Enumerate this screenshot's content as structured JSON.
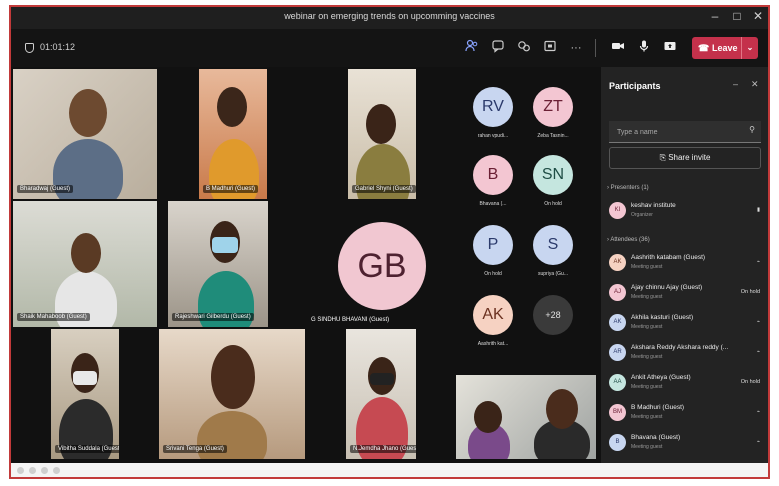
{
  "window": {
    "title": "webinar on emerging trends on upcomming vaccines",
    "minimize": "–",
    "maximize": "□",
    "close": "✕"
  },
  "toolbar": {
    "timer": "01:01:12",
    "leave_label": "Leave",
    "icons": [
      "people-icon",
      "chat-icon",
      "reactions-icon",
      "share-tray-icon",
      "more-icon",
      "camera-icon",
      "mic-icon",
      "share-screen-icon"
    ]
  },
  "video_tiles": [
    {
      "name": "Bharadwaj (Guest)"
    },
    {
      "name": "B Madhuri (Guest)"
    },
    {
      "name": "Gabriel Shyni (Guest)"
    },
    {
      "name": "Shaik Mahaboob (Guest)"
    },
    {
      "name": "Rajeshwari Gilberdu (Guest)"
    },
    {
      "name": "Vibitha Suddala (Guest)"
    },
    {
      "name": "Srivani Tenga (Guest)"
    },
    {
      "name": "N.Jemdha Jhano (Guest)"
    }
  ],
  "big_avatar": {
    "initials": "GB",
    "name": "G SINDHU BHAVANI (Guest)"
  },
  "grid_avatars": [
    {
      "initials": "RV",
      "name": "rahan vpudi...",
      "bg": "#c8d6f0",
      "fg": "#2b3a6b"
    },
    {
      "initials": "ZT",
      "name": "Zeba Tasnin...",
      "bg": "#f3c6d2",
      "fg": "#6b2035"
    },
    {
      "initials": "B",
      "name": "Bhavana (...",
      "bg": "#f3c6d2",
      "fg": "#6b2035"
    },
    {
      "initials": "SN",
      "name": "On hold",
      "bg": "#c5e6df",
      "fg": "#1f4d45"
    },
    {
      "initials": "P",
      "name": "On hold",
      "bg": "#c8d6f0",
      "fg": "#2b3a6b"
    },
    {
      "initials": "S",
      "name": "supriya (Gu...",
      "bg": "#c8d6f0",
      "fg": "#2b3a6b"
    },
    {
      "initials": "AK",
      "name": "Aashrith kat...",
      "bg": "#f6d2c2",
      "fg": "#6b3120"
    },
    {
      "initials": "+28",
      "name": "",
      "bg": "#3a3a3a",
      "fg": "#e0e0e0"
    }
  ],
  "participants": {
    "title": "Participants",
    "search_placeholder": "Type a name",
    "share_invite": "Share invite",
    "presenters_header": "Presenters (1)",
    "attendees_header": "Attendees (36)",
    "presenters": [
      {
        "initials": "KI",
        "name": "keshav institute",
        "role": "Organizer",
        "status": ""
      }
    ],
    "attendees": [
      {
        "initials": "AK",
        "name": "Aashrith katabam (Guest)",
        "role": "Meeting guest",
        "status": ""
      },
      {
        "initials": "AJ",
        "name": "Ajay chinnu Ajay (Guest)",
        "role": "Meeting guest",
        "status": "On hold"
      },
      {
        "initials": "AK",
        "name": "Akhila kasturi (Guest)",
        "role": "Meeting guest",
        "status": ""
      },
      {
        "initials": "AR",
        "name": "Akshara Reddy Akshara reddy (...",
        "role": "Meeting guest",
        "status": ""
      },
      {
        "initials": "AA",
        "name": "Ankit Atheya (Guest)",
        "role": "Meeting guest",
        "status": "On hold"
      },
      {
        "initials": "BM",
        "name": "B Madhuri (Guest)",
        "role": "Meeting guest",
        "status": ""
      },
      {
        "initials": "B",
        "name": "Bhavana (Guest)",
        "role": "Meeting guest",
        "status": ""
      }
    ]
  },
  "colors": {
    "leave": "#c4314b",
    "frame_border": "#c23a3a"
  }
}
